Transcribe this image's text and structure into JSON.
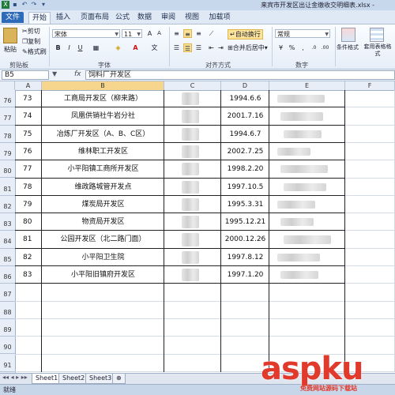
{
  "window": {
    "title": "来宾市开发区出让金缴收交明细表.xlsx -"
  },
  "tabs": [
    "文件",
    "开始",
    "插入",
    "页面布局",
    "公式",
    "数据",
    "审阅",
    "视图",
    "加载项"
  ],
  "ribbon": {
    "paste_label": "粘贴",
    "cut_label": "剪切",
    "copy_label": "复制",
    "format_painter_label": "格式刷",
    "clipboard_group": "剪贴板",
    "font_name": "宋体",
    "font_size": "11",
    "bold": "B",
    "italic": "I",
    "underline": "U",
    "font_group": "字体",
    "wrap_text_label": "自动换行",
    "merge_center_label": "合并后居中",
    "align_group": "对齐方式",
    "number_format": "常规",
    "number_group": "数字",
    "conditional_format_label": "条件格式",
    "table_format_label": "套用表格格式",
    "percent": "%",
    "comma": ","
  },
  "formula_bar": {
    "name_box": "B5",
    "fx": "fx",
    "content": "饲料厂开发区"
  },
  "columns": [
    "A",
    "B",
    "C",
    "D",
    "E",
    "F"
  ],
  "rows": [
    {
      "num": "76",
      "a": "73",
      "b": "工商局开发区（柳来路）",
      "d": "1994.6.6"
    },
    {
      "num": "77",
      "a": "74",
      "b": "凤凰供销社牛岩分社",
      "d": "2001.7.16"
    },
    {
      "num": "78",
      "a": "75",
      "b": "冶炼厂开发区（A、B、C区）",
      "d": "1994.6.7"
    },
    {
      "num": "79",
      "a": "76",
      "b": "维林职工开发区",
      "d": "2002.7.25"
    },
    {
      "num": "80",
      "a": "77",
      "b": "小平阳镇工商所开发区",
      "d": "1998.2.20"
    },
    {
      "num": "81",
      "a": "78",
      "b": "维政路城管开发点",
      "d": "1997.10.5"
    },
    {
      "num": "82",
      "a": "79",
      "b": "煤炭局开发区",
      "d": "1995.3.31"
    },
    {
      "num": "83",
      "a": "80",
      "b": "物资局开发区",
      "d": "1995.12.21"
    },
    {
      "num": "84",
      "a": "81",
      "b": "公园开发区（北二路门面）",
      "d": "2000.12.26"
    },
    {
      "num": "85",
      "a": "82",
      "b": "小平阳卫生院",
      "d": "1997.8.12"
    },
    {
      "num": "86",
      "a": "83",
      "b": "小平阳旧镇府开发区",
      "d": "1997.1.20"
    },
    {
      "num": "87",
      "a": "",
      "b": "",
      "d": ""
    },
    {
      "num": "88",
      "a": "",
      "b": "",
      "d": ""
    },
    {
      "num": "89",
      "a": "",
      "b": "",
      "d": ""
    },
    {
      "num": "90",
      "a": "",
      "b": "",
      "d": ""
    },
    {
      "num": "91",
      "a": "",
      "b": "",
      "d": ""
    }
  ],
  "sheets": [
    "Sheet1",
    "Sheet2",
    "Sheet3"
  ],
  "status": "就绪",
  "watermark": {
    "logo": "aspku",
    "sub": "免费网站源码下载站"
  }
}
